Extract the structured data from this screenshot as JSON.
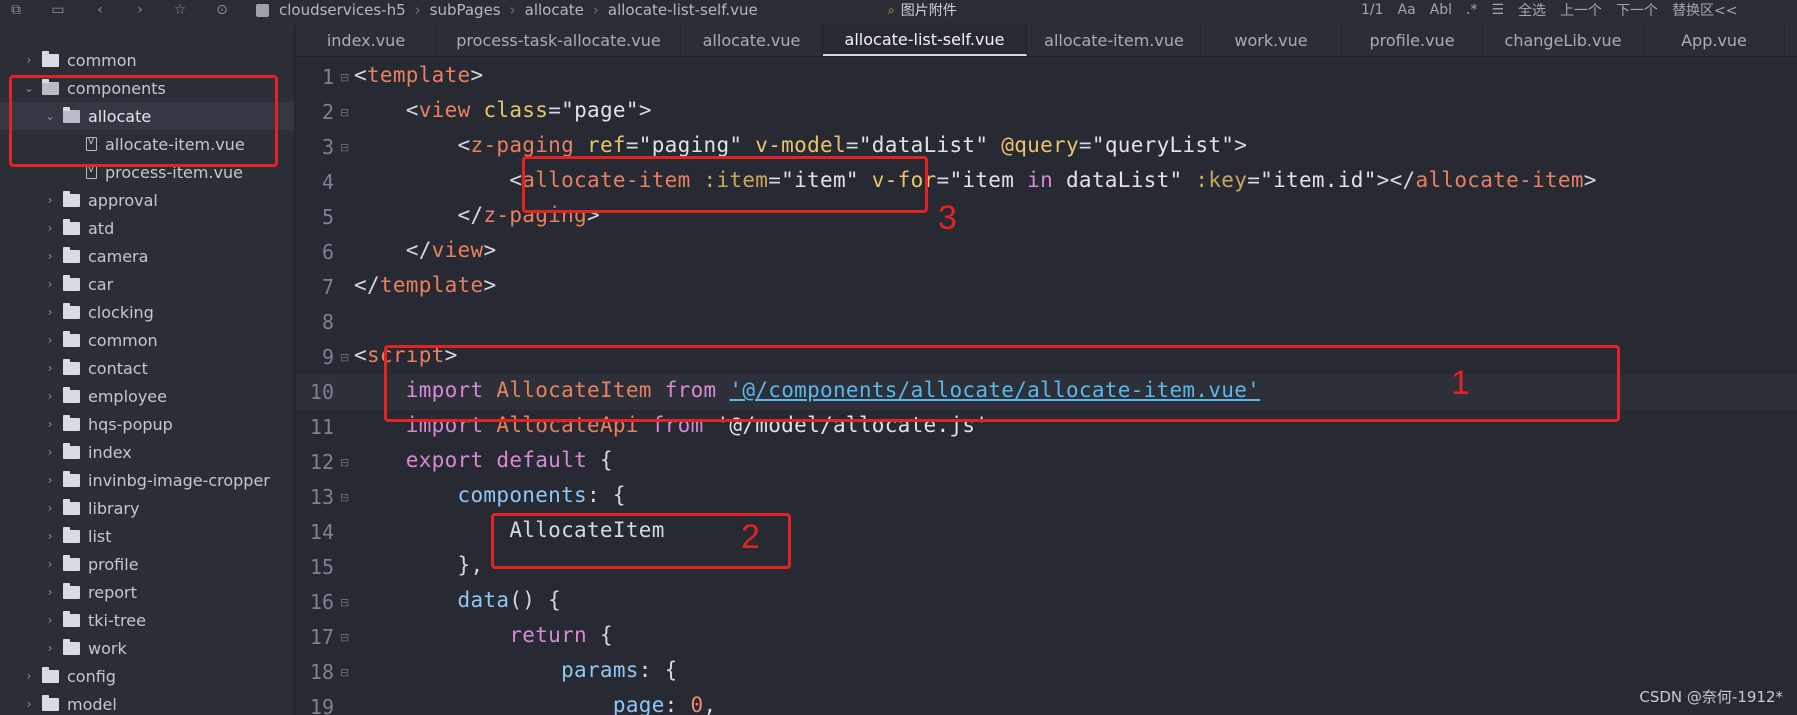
{
  "toolbar": {
    "breadcrumb": [
      "cloudservices-h5",
      "subPages",
      "allocate",
      "allocate-list-self.vue"
    ],
    "find_label": "图片附件",
    "match_count": "1/1",
    "case_label": "Aa",
    "word_label": "Abl",
    "select_all": "全选",
    "prev": "上一个",
    "next": "下一个",
    "replace": "替换区<<"
  },
  "sidebar": {
    "items": [
      {
        "label": "common",
        "type": "folder"
      },
      {
        "label": "components",
        "type": "folder"
      },
      {
        "label": "allocate",
        "type": "folder"
      },
      {
        "label": "allocate-item.vue",
        "type": "file"
      },
      {
        "label": "process-item.vue",
        "type": "file"
      },
      {
        "label": "approval",
        "type": "folder"
      },
      {
        "label": "atd",
        "type": "folder"
      },
      {
        "label": "camera",
        "type": "folder"
      },
      {
        "label": "car",
        "type": "folder"
      },
      {
        "label": "clocking",
        "type": "folder"
      },
      {
        "label": "common",
        "type": "folder"
      },
      {
        "label": "contact",
        "type": "folder"
      },
      {
        "label": "employee",
        "type": "folder"
      },
      {
        "label": "hqs-popup",
        "type": "folder"
      },
      {
        "label": "index",
        "type": "folder"
      },
      {
        "label": "invinbg-image-cropper",
        "type": "folder"
      },
      {
        "label": "library",
        "type": "folder"
      },
      {
        "label": "list",
        "type": "folder"
      },
      {
        "label": "profile",
        "type": "folder"
      },
      {
        "label": "report",
        "type": "folder"
      },
      {
        "label": "tki-tree",
        "type": "folder"
      },
      {
        "label": "work",
        "type": "folder"
      },
      {
        "label": "config",
        "type": "folder"
      },
      {
        "label": "model",
        "type": "folder"
      }
    ]
  },
  "tabs": [
    {
      "label": "index.vue"
    },
    {
      "label": "process-task-allocate.vue"
    },
    {
      "label": "allocate.vue"
    },
    {
      "label": "allocate-list-self.vue",
      "active": true
    },
    {
      "label": "allocate-item.vue"
    },
    {
      "label": "work.vue"
    },
    {
      "label": "profile.vue"
    },
    {
      "label": "changeLib.vue"
    },
    {
      "label": "App.vue"
    }
  ],
  "editor": {
    "line_numbers": [
      "1",
      "2",
      "3",
      "4",
      "5",
      "6",
      "7",
      "8",
      "9",
      "10",
      "11",
      "12",
      "13",
      "14",
      "15",
      "16",
      "17",
      "18",
      "19"
    ],
    "code": {
      "l1_open": "<",
      "l1_tag": "template",
      "l1_close": ">",
      "l2_indent": "    ",
      "l2_open": "<",
      "l2_tag": "view",
      "l2_attr": "class",
      "l2_eq": "=",
      "l2_val": "\"page\"",
      "l2_close": ">",
      "l3_indent": "        ",
      "l3_open": "<",
      "l3_tag": "z-paging",
      "l3_attr1": "ref",
      "l3_eq1": "=",
      "l3_val1": "\"paging\"",
      "l3_attr2": "v-model",
      "l3_eq2": "=",
      "l3_val2": "\"dataList\"",
      "l3_attr3": "@query",
      "l3_eq3": "=",
      "l3_val3": "\"queryList\"",
      "l3_close": ">",
      "l4_indent": "            ",
      "l4_open": "<",
      "l4_tag": "allocate-item",
      "l4_attr1": ":item",
      "l4_eq1": "=",
      "l4_val1": "\"item\"",
      "l4_attr2": "v-for",
      "l4_eq2": "=",
      "l4_val2a": "\"item ",
      "l4_in": "in",
      "l4_val2b": " dataList\"",
      "l4_attr3": ":key",
      "l4_eq3": "=",
      "l4_val3": "\"item.id\"",
      "l4_close": "></",
      "l4_tag2": "allocate-item",
      "l4_end": ">",
      "l5_indent": "        ",
      "l5_open": "</",
      "l5_tag": "z-paging",
      "l5_close": ">",
      "l6_indent": "    ",
      "l6_open": "</",
      "l6_tag": "view",
      "l6_close": ">",
      "l7_open": "</",
      "l7_tag": "template",
      "l7_close": ">",
      "l9_open": "<",
      "l9_tag": "script",
      "l9_close": ">",
      "l10_indent": "    ",
      "l10_kw1": "import",
      "l10_cls": "AllocateItem",
      "l10_kw2": "from",
      "l10_path": "'@/components/allocate/allocate-item.vue'",
      "l11_indent": "    ",
      "l11_kw1": "import",
      "l11_cls": "AllocateApi",
      "l11_kw2": "from",
      "l11_path": "'@/model/allocate.js'",
      "l12_indent": "    ",
      "l12_kw1": "export",
      "l12_kw2": "default",
      "l12_brace": "{",
      "l13_indent": "        ",
      "l13_key": "components",
      "l13_rest": ": {",
      "l14_indent": "            ",
      "l14_cls": "AllocateItem",
      "l15_indent": "        ",
      "l15_text": "},",
      "l16_indent": "        ",
      "l16_fn": "data",
      "l16_rest": "() {",
      "l17_indent": "            ",
      "l17_kw": "return",
      "l17_rest": "{",
      "l18_indent": "                ",
      "l18_key": "params",
      "l18_rest": ": {",
      "l19_indent": "                    ",
      "l19_key": "page",
      "l19_colon": ": ",
      "l19_num": "0",
      "l19_comma": ","
    }
  },
  "annotations": [
    "1",
    "2",
    "3"
  ],
  "watermark": "CSDN @奈何-1912*"
}
